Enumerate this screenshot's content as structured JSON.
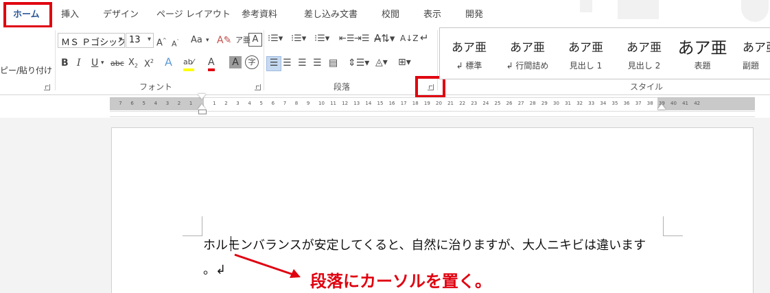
{
  "tabs": [
    "ホーム",
    "挿入",
    "デザイン",
    "ページ レイアウト",
    "参考資料",
    "差し込み文書",
    "校閲",
    "表示",
    "開発"
  ],
  "active_tab": "ホーム",
  "clipboard": {
    "paste_label": "ピー/貼り付け"
  },
  "font": {
    "family": "ＭＳ Ｐゴシック",
    "size": "13",
    "group_label": "フォント",
    "case_label": "Aa"
  },
  "paragraph": {
    "group_label": "段落"
  },
  "styles": {
    "group_label": "スタイル",
    "items": [
      {
        "sample": "あア亜",
        "name": "↲ 標準"
      },
      {
        "sample": "あア亜",
        "name": "↲ 行間詰め"
      },
      {
        "sample": "あア亜",
        "name": "見出し 1"
      },
      {
        "sample": "あア亜",
        "name": "見出し 2"
      },
      {
        "sample": "あア亜",
        "name": "表題"
      },
      {
        "sample": "あア亜",
        "name": "副題"
      }
    ]
  },
  "ruler": {
    "left_numbers": [
      "7",
      "6",
      "5",
      "4",
      "3",
      "2",
      "1"
    ],
    "right_numbers": [
      "1",
      "2",
      "3",
      "4",
      "5",
      "6",
      "7",
      "8",
      "9",
      "10",
      "11",
      "12",
      "13",
      "14",
      "15",
      "16",
      "17",
      "18",
      "19",
      "20",
      "21",
      "22",
      "23",
      "24",
      "25",
      "26",
      "27",
      "28",
      "29",
      "30",
      "31",
      "32",
      "33",
      "34",
      "35",
      "36",
      "37",
      "38",
      "39",
      "40",
      "41",
      "42"
    ]
  },
  "document": {
    "line1": "ホルモンバランスが安定してくると、自然に治りますが、大人ニキビは違います",
    "line2": "。↲"
  },
  "annotation": "段落にカーソルを置く。",
  "colors": {
    "highlight": "#e0000f",
    "accent": "#2b579a"
  }
}
